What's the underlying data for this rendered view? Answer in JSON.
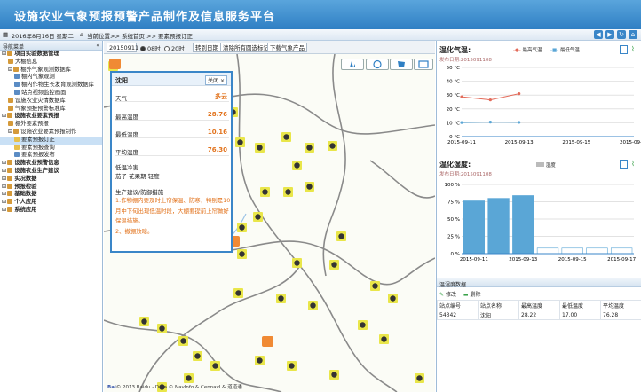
{
  "app": {
    "title": "设施农业气象预报预警产品制作及信息服务平台"
  },
  "statusbar": {
    "date": "2016年8月16日 星期二",
    "location_label": "当前位置",
    "breadcrumb": ">> 系统首页 >> 要素预报订正"
  },
  "sidebar": {
    "title": "导航菜单",
    "collapse": "«",
    "items": [
      {
        "label": "项目实验数据管理",
        "level": 0,
        "expander": "⊟",
        "color": "#d59a3a"
      },
      {
        "label": "大棚信息",
        "level": 1,
        "color": "#d59a3a"
      },
      {
        "label": "棚外气象观测数据库",
        "level": 1,
        "expander": "⊟",
        "color": "#d59a3a"
      },
      {
        "label": "棚内气象观测",
        "level": 2,
        "color": "#5b8cc4"
      },
      {
        "label": "棚内作物生长发育观测数据库",
        "level": 2,
        "color": "#5b8cc4"
      },
      {
        "label": "站点视频监控画面",
        "level": 2,
        "color": "#5b8cc4"
      },
      {
        "label": "设施农业灾情数据库",
        "level": 1,
        "color": "#d59a3a"
      },
      {
        "label": "气象预报预警标准库",
        "level": 1,
        "color": "#d59a3a"
      },
      {
        "label": "设施农业要素预报",
        "level": 0,
        "expander": "⊟",
        "color": "#d59a3a"
      },
      {
        "label": "棚外要素预报",
        "level": 1,
        "color": "#d59a3a"
      },
      {
        "label": "设施农业要素预报制作",
        "level": 1,
        "expander": "⊟",
        "color": "#d59a3a"
      },
      {
        "label": "要素预报订正",
        "level": 2,
        "color": "#e8c04a",
        "selected": true
      },
      {
        "label": "要素预报查询",
        "level": 2,
        "color": "#e8c04a"
      },
      {
        "label": "要素预报发布",
        "level": 2,
        "color": "#5b8cc4"
      },
      {
        "label": "设施农业预警信息",
        "level": 0,
        "expander": "⊞",
        "color": "#d59a3a"
      },
      {
        "label": "设施农业生产建议",
        "level": 0,
        "expander": "⊞",
        "color": "#d59a3a"
      },
      {
        "label": "实况数据",
        "level": 0,
        "expander": "⊞",
        "color": "#d59a3a"
      },
      {
        "label": "预报检验",
        "level": 0,
        "expander": "⊞",
        "color": "#d59a3a"
      },
      {
        "label": "基础数据",
        "level": 0,
        "expander": "⊞",
        "color": "#d59a3a"
      },
      {
        "label": "个人应用",
        "level": 0,
        "expander": "⊞",
        "color": "#d59a3a"
      },
      {
        "label": "系统应用",
        "level": 0,
        "expander": "⊞",
        "color": "#d59a3a"
      }
    ]
  },
  "toolbar": {
    "date_value": "20150911",
    "radio_08": "08时",
    "radio_20": "20时",
    "btn_switch": "转到日期",
    "btn_clear": "清除所有圆选标记",
    "btn_download": "下载气象产品"
  },
  "popup": {
    "title": "沈阳",
    "close": "关闭",
    "rows": [
      {
        "k": "天气",
        "v": "多云"
      },
      {
        "k": "最高温度",
        "v": "28.76"
      },
      {
        "k": "最低温度",
        "v": "10.16"
      },
      {
        "k": "平均温度",
        "v": "76.30"
      }
    ],
    "crop_label": "低温冷害",
    "crop_detail": "茄子 花果期 轻度",
    "advice_title": "生产建议/防御措施",
    "advice": "1.作物棚内要及时上帘保温、防寒，特别是10月中下旬出现低温时段，大棚要提前上帘做好保温措施。",
    "advice2": "2、撤棚放晾。"
  },
  "map": {
    "footer": "© 2013 Baidu - Data © NavInfo & CennavI & 道道通"
  },
  "temp_chart": {
    "title": "温化气温:",
    "publish": "发布日期:2015091108",
    "legend_max": "最高气温",
    "legend_min": "最低气温",
    "chart_data": {
      "type": "line",
      "x": [
        "2015-09-11",
        "2015-09-12",
        "2015-09-13",
        "2015-09-14",
        "2015-09-15",
        "2015-09-16",
        "2015-09-17"
      ],
      "series": [
        {
          "name": "最高气温",
          "values": [
            28.76,
            26.5,
            31.0,
            null,
            null,
            null,
            null
          ]
        },
        {
          "name": "最低气温",
          "values": [
            10.16,
            10.5,
            10.3,
            null,
            null,
            null,
            null
          ]
        }
      ],
      "ylim": [
        0,
        50
      ],
      "yticks": [
        "0 °C",
        "10 °C",
        "20 °C",
        "30 °C",
        "40 °C",
        "50 °C"
      ],
      "xticks": [
        "2015-09-11",
        "2015-09-13",
        "2015-09-15",
        "2015-09-17"
      ]
    }
  },
  "hum_chart": {
    "title": "温化湿度:",
    "publish": "发布日期:2015091108",
    "legend": "湿度",
    "chart_data": {
      "type": "bar",
      "categories": [
        "2015-09-11",
        "2015-09-12",
        "2015-09-13",
        "2015-09-14",
        "2015-09-15",
        "2015-09-16",
        "2015-09-17"
      ],
      "values": [
        76.28,
        80,
        84,
        8,
        8,
        8,
        8
      ],
      "ylim": [
        0,
        100
      ],
      "yticks": [
        "0 %",
        "25 %",
        "50 %",
        "75 %",
        "100 %"
      ],
      "xticks": [
        "2015-09-11",
        "2015-09-13",
        "2015-09-15",
        "2015-09-17"
      ]
    }
  },
  "table": {
    "title": "温湿度数据",
    "btn_edit": "修改",
    "btn_delete": "删除",
    "headers": [
      "站点编号",
      "站点名称",
      "最高温度",
      "最低温度",
      "平均温度"
    ],
    "rows": [
      [
        "54342",
        "沈阳",
        "28.22",
        "17.00",
        "76.28"
      ]
    ]
  },
  "colors": {
    "header": "#2f7fc4",
    "accent": "#e2731d",
    "line_max": "#e36b5a",
    "line_min": "#5aa6d6",
    "bar": "#5aa6d6"
  }
}
